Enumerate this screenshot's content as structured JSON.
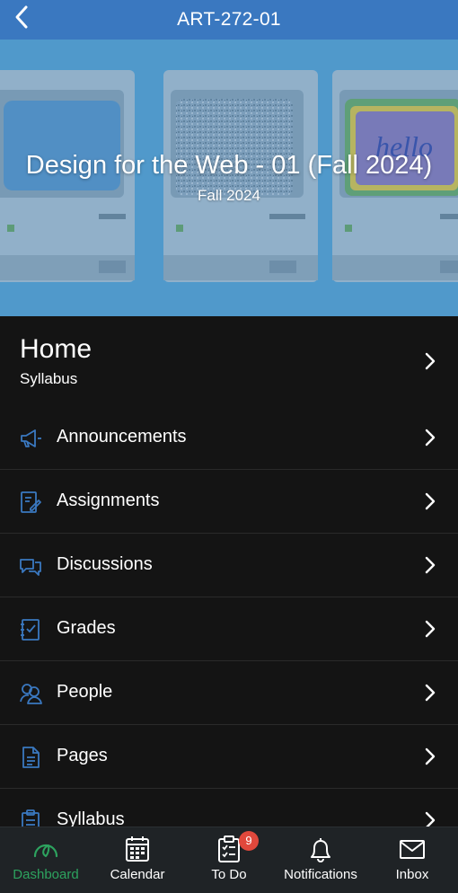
{
  "header": {
    "title": "ART-272-01"
  },
  "hero": {
    "course_name": "Design for the Web - 01 (Fall 2024)",
    "term": "Fall 2024",
    "screen_text": "hello"
  },
  "home": {
    "title": "Home",
    "subtitle": "Syllabus"
  },
  "menu": {
    "items": [
      {
        "label": "Announcements",
        "icon": "megaphone-icon"
      },
      {
        "label": "Assignments",
        "icon": "assignment-icon"
      },
      {
        "label": "Discussions",
        "icon": "discussion-icon"
      },
      {
        "label": "Grades",
        "icon": "grades-icon"
      },
      {
        "label": "People",
        "icon": "people-icon"
      },
      {
        "label": "Pages",
        "icon": "page-icon"
      },
      {
        "label": "Syllabus",
        "icon": "syllabus-icon"
      }
    ]
  },
  "tabbar": {
    "tabs": [
      {
        "label": "Dashboard",
        "icon": "dashboard-icon",
        "active": true
      },
      {
        "label": "Calendar",
        "icon": "calendar-icon"
      },
      {
        "label": "To Do",
        "icon": "todo-icon",
        "badge": "9"
      },
      {
        "label": "Notifications",
        "icon": "bell-icon"
      },
      {
        "label": "Inbox",
        "icon": "inbox-icon"
      }
    ]
  },
  "colors": {
    "header_bg": "#3a78c0",
    "accent_icon": "#3a78c0",
    "active_tab": "#2da35f",
    "badge": "#e0483c",
    "background": "#141414"
  }
}
